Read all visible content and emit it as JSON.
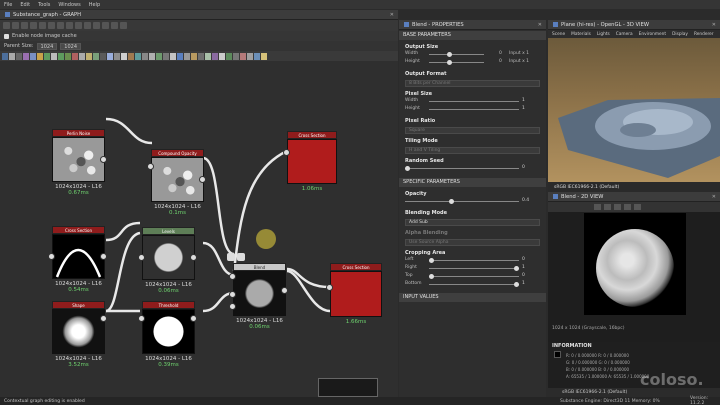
{
  "menu": [
    "File",
    "Edit",
    "Tools",
    "Windows",
    "Help"
  ],
  "graph_panel": {
    "title": "Substance_graph - GRAPH",
    "cache_label": "Enable node image cache",
    "parent_size_label": "Parent Size:",
    "parent_size_w": "1024",
    "parent_size_h": "1024",
    "nodes": [
      {
        "name": "Perlin Noise",
        "info": "1024x1024 - L16",
        "time": "0.67ms"
      },
      {
        "name": "Compound Opacity",
        "info": "1024x1024 - L16",
        "time": "0.1ms"
      },
      {
        "name": "Cross Section",
        "info": "",
        "time": "1.06ms"
      },
      {
        "name": "Cross Section",
        "info": "1024x1024 - L16",
        "time": "0.54ms"
      },
      {
        "name": "Levels",
        "info": "1024x1024 - L16",
        "time": "0.06ms"
      },
      {
        "name": "Blend",
        "info": "1024x1024 - L16",
        "time": "0.06ms"
      },
      {
        "name": "Cross Section",
        "info": "",
        "time": "1.66ms"
      },
      {
        "name": "Shape",
        "info": "1024x1024 - L16",
        "time": "3.52ms"
      },
      {
        "name": "Threshold",
        "info": "1024x1024 - L16",
        "time": "0.39ms"
      }
    ]
  },
  "properties": {
    "title": "Blend - PROPERTIES",
    "base_header": "BASE PARAMETERS",
    "output_size": {
      "label": "Output Size",
      "width_label": "Width",
      "height_label": "Height",
      "width_val": "0",
      "height_val": "0",
      "width_mode": "Input x 1",
      "height_mode": "Input x 1"
    },
    "output_format": {
      "label": "Output Format",
      "value": "8 Bits per Channel"
    },
    "pixel_size": {
      "label": "Pixel Size",
      "width_label": "Width",
      "height_label": "Height",
      "width_val": "1",
      "height_val": "1"
    },
    "pixel_ratio": {
      "label": "Pixel Ratio",
      "value": "Square"
    },
    "tiling_mode": {
      "label": "Tiling Mode",
      "value": "H and V Tiling"
    },
    "random_seed": {
      "label": "Random Seed",
      "value": "0"
    },
    "specific_header": "SPECIFIC PARAMETERS",
    "opacity": {
      "label": "Opacity",
      "value": "0.4",
      "fraction": 0.4
    },
    "blending_mode": {
      "label": "Blending Mode",
      "value": "Add Sub"
    },
    "alpha_blending": {
      "label": "Alpha Blending",
      "value": "Use Source Alpha"
    },
    "cropping": {
      "label": "Cropping Area",
      "left_label": "Left",
      "right_label": "Right",
      "top_label": "Top",
      "bottom_label": "Bottom",
      "left": "0",
      "right": "1",
      "top": "0",
      "bottom": "1"
    },
    "input_header": "INPUT VALUES"
  },
  "view3d": {
    "title": "Plane (hi-res) - OpenGL - 3D VIEW",
    "tabs": [
      "Scene",
      "Materials",
      "Lights",
      "Camera",
      "Environment",
      "Display",
      "Renderer"
    ],
    "colorspace": "sRGB IEC61966-2.1 (Default)"
  },
  "view2d": {
    "title": "Blend - 2D VIEW",
    "size_info": "1024 x 1024 (Grayscale, 16bpc)",
    "colorspace": "sRGB IEC61966-2.1 (Default)"
  },
  "info": {
    "title": "INFORMATION",
    "rows": [
      "R:     0 / 0.000000     R:     0 / 0.000000",
      "G:     0 / 0.000000     G:     0 / 0.000000",
      "B:     0 / 0.000000     B:     0 / 0.000000",
      "A: 65535 / 1.000000     A: 65535 / 1.000000"
    ]
  },
  "status": {
    "left": "Contextual graph editing is enabled",
    "right": "Substance Engine: Direct3D 11  Memory: 0%",
    "version": "Version: 11.2.2"
  },
  "watermark": "coloso.",
  "colors": {
    "node_red": "#8f1c1c",
    "node_green": "#5e7e57",
    "timing": "#6fd36f",
    "accent": "#5a7fbf"
  }
}
